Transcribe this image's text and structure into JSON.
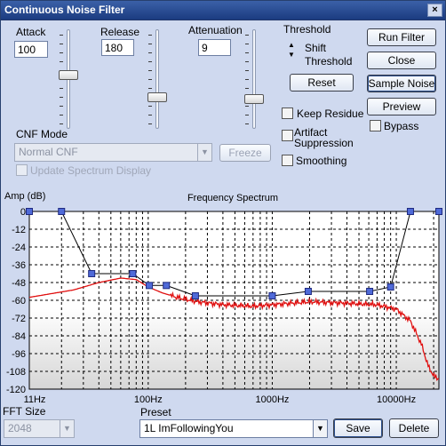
{
  "window": {
    "title": "Continuous Noise Filter",
    "close_glyph": "×"
  },
  "attack": {
    "label": "Attack",
    "value": "100",
    "level": 0.45
  },
  "release": {
    "label": "Release",
    "value": "180",
    "level": 0.7
  },
  "attenuation": {
    "label": "Attenuation",
    "value": "9",
    "level": 0.72
  },
  "threshold": {
    "label": "Threshold",
    "shift_line1": "Shift",
    "shift_line2": "Threshold",
    "reset_label": "Reset"
  },
  "buttons": {
    "run": "Run Filter",
    "close": "Close",
    "sample": "Sample Noise",
    "preview": "Preview",
    "freeze": "Freeze",
    "save": "Save",
    "delete": "Delete"
  },
  "options": {
    "keep_residue": "Keep Residue",
    "artifact_1": "Artifact",
    "artifact_2": "Suppression",
    "smoothing": "Smoothing",
    "bypass": "Bypass"
  },
  "cnf": {
    "label": "CNF Mode",
    "value": "Normal CNF",
    "update_label": "Update Spectrum Display"
  },
  "fft": {
    "label": "FFT Size",
    "value": "2048"
  },
  "preset": {
    "label": "Preset",
    "value": "1L ImFollowingYou"
  },
  "colors": {
    "curve": "#e01010",
    "points": "#4f6ad8",
    "accent": "#1b3b80"
  },
  "chart_data": {
    "type": "line",
    "title": "Frequency Spectrum",
    "ylabel": "Amp (dB)",
    "xscale": "log",
    "xlim": [
      11,
      22050
    ],
    "ylim": [
      -120,
      0
    ],
    "yticks": [
      0,
      -12,
      -24,
      -36,
      -48,
      -60,
      -72,
      -84,
      -96,
      -108,
      -120
    ],
    "xticks": [
      {
        "value": 11,
        "label": "11Hz"
      },
      {
        "value": 100,
        "label": "100Hz"
      },
      {
        "value": 1000,
        "label": "1000Hz"
      },
      {
        "value": 10000,
        "label": "10000Hz"
      }
    ],
    "grid": true,
    "threshold_points": [
      {
        "x": 11,
        "y": 0
      },
      {
        "x": 20,
        "y": 0
      },
      {
        "x": 35,
        "y": -42
      },
      {
        "x": 75,
        "y": -42
      },
      {
        "x": 102,
        "y": -50
      },
      {
        "x": 140,
        "y": -50
      },
      {
        "x": 240,
        "y": -57
      },
      {
        "x": 1000,
        "y": -57
      },
      {
        "x": 1950,
        "y": -54
      },
      {
        "x": 6100,
        "y": -54
      },
      {
        "x": 9000,
        "y": -51
      },
      {
        "x": 13000,
        "y": 0
      },
      {
        "x": 22050,
        "y": 0
      }
    ],
    "spectrum": [
      {
        "x": 11,
        "y": -58
      },
      {
        "x": 25,
        "y": -53
      },
      {
        "x": 40,
        "y": -48
      },
      {
        "x": 60,
        "y": -45
      },
      {
        "x": 80,
        "y": -46
      },
      {
        "x": 100,
        "y": -51
      },
      {
        "x": 130,
        "y": -55
      },
      {
        "x": 170,
        "y": -58
      },
      {
        "x": 250,
        "y": -61
      },
      {
        "x": 400,
        "y": -63
      },
      {
        "x": 700,
        "y": -64
      },
      {
        "x": 1000,
        "y": -63
      },
      {
        "x": 2000,
        "y": -61
      },
      {
        "x": 4000,
        "y": -62
      },
      {
        "x": 7000,
        "y": -63
      },
      {
        "x": 10000,
        "y": -66
      },
      {
        "x": 13000,
        "y": -74
      },
      {
        "x": 16000,
        "y": -90
      },
      {
        "x": 18000,
        "y": -104
      },
      {
        "x": 20000,
        "y": -111
      },
      {
        "x": 22050,
        "y": -113
      }
    ]
  }
}
